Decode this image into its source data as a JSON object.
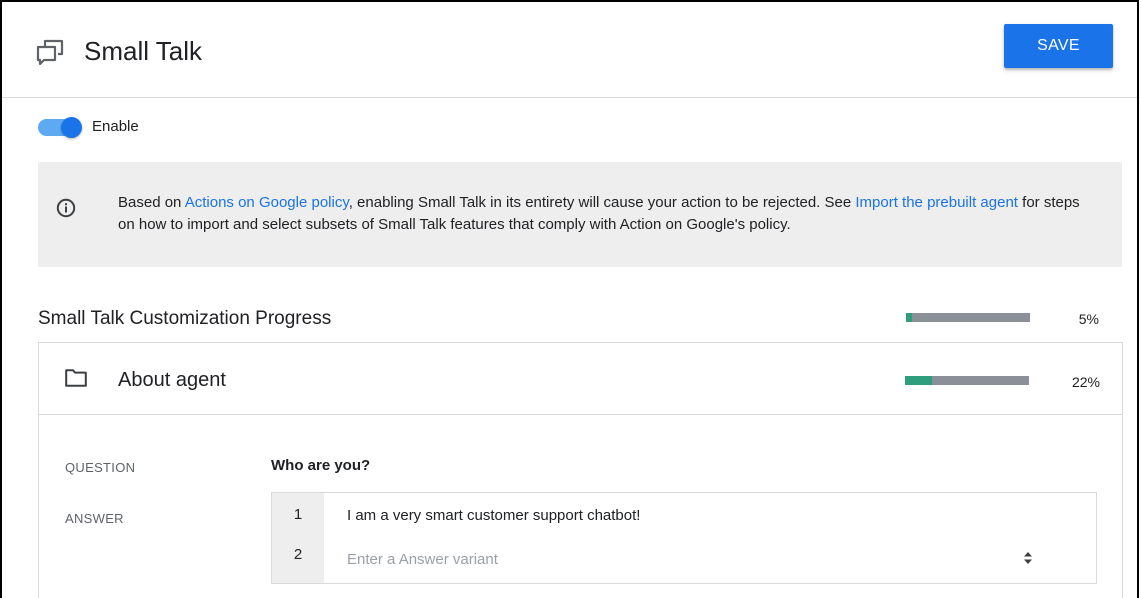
{
  "header": {
    "title": "Small Talk",
    "save_label": "SAVE",
    "title_icon": "chat-bubbles-icon"
  },
  "enable": {
    "label": "Enable",
    "checked": true
  },
  "info": {
    "icon": "info-icon",
    "text_1": "Based on ",
    "link_1": "Actions on Google policy",
    "text_2": ", enabling Small Talk in its entirety will cause your action to be rejected. See ",
    "link_2": "Import the prebuilt agent",
    "text_3": " for steps on how to import and select subsets of Small Talk features that comply with Action on Google's policy."
  },
  "progress": {
    "title": "Small Talk Customization Progress",
    "percent_label": "5%",
    "value": 0.05
  },
  "panel": {
    "title": "About agent",
    "icon": "folder-icon",
    "percent_label": "22%",
    "value": 0.22,
    "question_label": "QUESTION",
    "question": "Who are you?",
    "answer_label": "ANSWER",
    "answers": [
      {
        "num": "1",
        "text": "I am a very smart customer support chatbot!"
      },
      {
        "num": "2",
        "text": "",
        "placeholder": "Enter a Answer variant"
      }
    ]
  },
  "colors": {
    "accent": "#1a73e8",
    "progress_fill": "#2e9e7d",
    "progress_track": "#8a8f98"
  }
}
